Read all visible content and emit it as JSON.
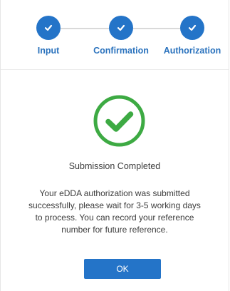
{
  "stepper": {
    "steps": [
      {
        "label": "Input",
        "icon": "check-icon",
        "status": "completed"
      },
      {
        "label": "Confirmation",
        "icon": "check-icon",
        "status": "completed"
      },
      {
        "label": "Authorization",
        "icon": "check-icon",
        "status": "completed"
      }
    ]
  },
  "result": {
    "icon": "success-check-icon",
    "title": "Submission Completed",
    "message": "Your eDDA authorization was submitted successfully, please wait for 3-5 working days to process. You can record your reference number for future reference."
  },
  "actions": {
    "ok_label": "OK"
  },
  "colors": {
    "primary": "#2474C8",
    "success": "#3DAA43",
    "text": "#3C3C3C",
    "step_line": "#D9D9D9"
  }
}
